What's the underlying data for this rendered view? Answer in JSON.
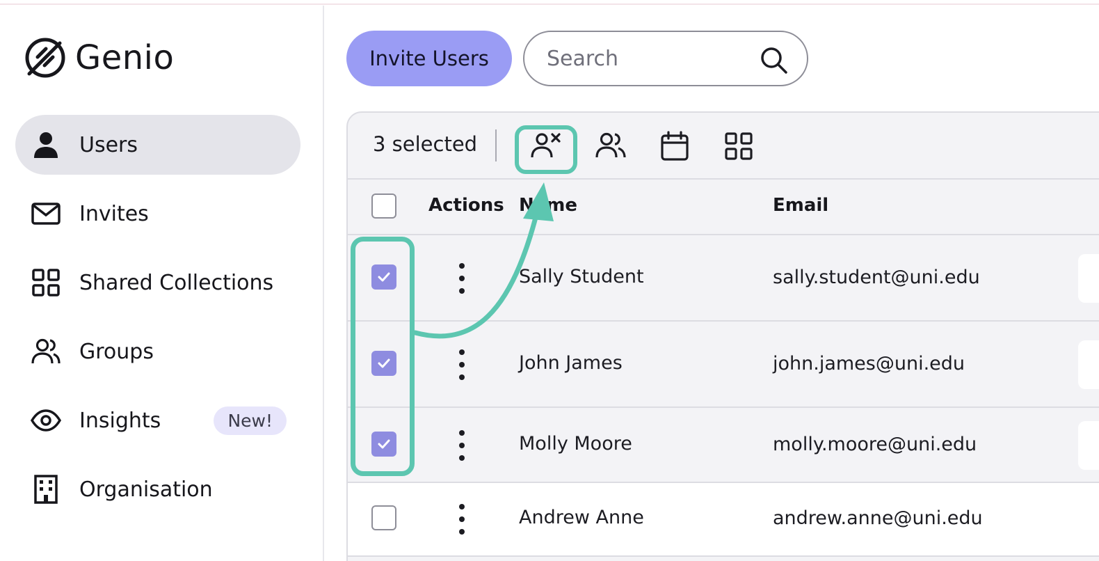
{
  "app": {
    "name": "Genio"
  },
  "sidebar": {
    "items": [
      {
        "label": "Users",
        "icon": "user-icon",
        "active": true
      },
      {
        "label": "Invites",
        "icon": "mail-icon"
      },
      {
        "label": "Shared Collections",
        "icon": "grid-icon"
      },
      {
        "label": "Groups",
        "icon": "users-icon"
      },
      {
        "label": "Insights",
        "icon": "eye-icon",
        "badge": "New!"
      },
      {
        "label": "Organisation",
        "icon": "building-icon"
      }
    ]
  },
  "header": {
    "invite_label": "Invite Users",
    "search_placeholder": "Search"
  },
  "toolbar": {
    "selected_text": "3 selected",
    "icons": [
      "remove-user-icon",
      "users-icon",
      "calendar-icon",
      "grid-icon"
    ]
  },
  "table": {
    "columns": {
      "actions": "Actions",
      "name": "Name",
      "email": "Email"
    },
    "rows": [
      {
        "name": "Sally Student",
        "email": "sally.student@uni.edu",
        "checked": true
      },
      {
        "name": "John James",
        "email": "john.james@uni.edu",
        "checked": true
      },
      {
        "name": "Molly Moore",
        "email": "molly.moore@uni.edu",
        "checked": true
      },
      {
        "name": "Andrew Anne",
        "email": "andrew.anne@uni.edu",
        "checked": false
      }
    ]
  },
  "colors": {
    "accent": "#9a9cf4",
    "highlight": "#5cc6b0",
    "checkbox": "#8e8ce0",
    "active_nav": "#e4e4ea"
  }
}
